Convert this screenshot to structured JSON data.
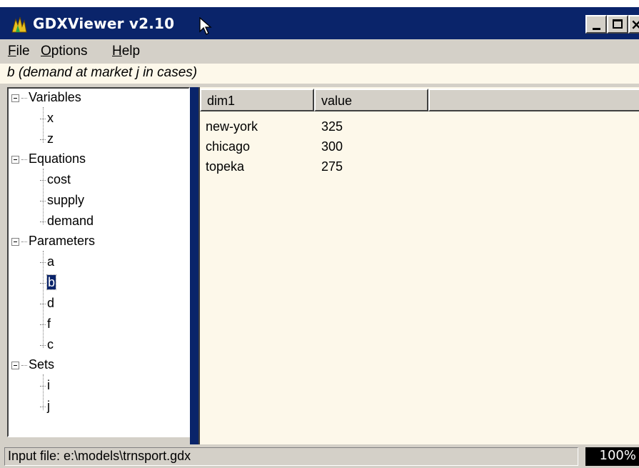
{
  "window": {
    "title": "GDXViewer v2.10"
  },
  "menu": {
    "items": [
      {
        "label": "File",
        "accel": "F",
        "rest": "ile"
      },
      {
        "label": "Options",
        "accel": "O",
        "rest": "ptions"
      },
      {
        "label": "Help",
        "accel": "H",
        "rest": "elp"
      }
    ]
  },
  "description": "b (demand at market j in cases)",
  "tree": {
    "groups": [
      {
        "label": "Variables",
        "children": [
          "x",
          "z"
        ]
      },
      {
        "label": "Equations",
        "children": [
          "cost",
          "supply",
          "demand"
        ]
      },
      {
        "label": "Parameters",
        "children": [
          "a",
          "b",
          "d",
          "f",
          "c"
        ]
      },
      {
        "label": "Sets",
        "children": [
          "i",
          "j"
        ]
      }
    ],
    "selected": "b"
  },
  "grid": {
    "columns": [
      "dim1",
      "value"
    ],
    "rows": [
      [
        "new-york",
        "325"
      ],
      [
        "chicago",
        "300"
      ],
      [
        "topeka",
        "275"
      ]
    ]
  },
  "status": {
    "input_file": "Input file: e:\\models\\trnsport.gdx",
    "progress": "100%"
  },
  "colors": {
    "titlebar": "#0a246a",
    "panel_background": "#fdf8ea",
    "chrome": "#d4d0c8"
  },
  "icons": {
    "app": "gdx-app-icon",
    "tree_expander": "minus-box-icon"
  }
}
